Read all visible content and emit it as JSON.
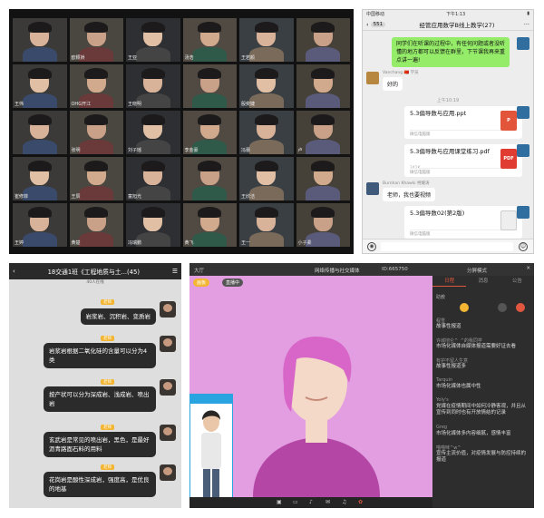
{
  "video_call": {
    "tiles": [
      {
        "name": ""
      },
      {
        "name": "欧颖娇"
      },
      {
        "name": "王亚"
      },
      {
        "name": "汤浩"
      },
      {
        "name": "王若颜"
      },
      {
        "name": ""
      },
      {
        "name": "王伟"
      },
      {
        "name": "OHG开江"
      },
      {
        "name": "王晓明"
      },
      {
        "name": ""
      },
      {
        "name": "殷奕婕"
      },
      {
        "name": ""
      },
      {
        "name": ""
      },
      {
        "name": "张明"
      },
      {
        "name": "刘子瑶"
      },
      {
        "name": "李金豪"
      },
      {
        "name": "冯蕾"
      },
      {
        "name": "卢"
      },
      {
        "name": "崔修菲"
      },
      {
        "name": "王辰"
      },
      {
        "name": "童旭光"
      },
      {
        "name": ""
      },
      {
        "name": "王欣洁"
      },
      {
        "name": ""
      },
      {
        "name": "王婷"
      },
      {
        "name": "黄楚"
      },
      {
        "name": "冯瑞鹏"
      },
      {
        "name": "黄飞"
      },
      {
        "name": "王一"
      },
      {
        "name": "小子柔"
      }
    ]
  },
  "wechat": {
    "status_left": "中国移动",
    "status_time": "下午1:13",
    "back_badge": "551",
    "title": "经管应用数学B线上教学(27)",
    "teacher_msg": "同学们在听课的过程中，有任何问题或者没听懂的地方都可以反馈在群里，下节课我再来重点讲一遍!",
    "student1_name": "Vanchang 🇨🇳 学员",
    "student1_msg": "好的",
    "time_divider": "上午10:19",
    "files": [
      {
        "name": "5.3偏导数与应用.ppt",
        "size": "",
        "type": "P",
        "color": "#e2553a"
      },
      {
        "name": "5.3偏导数与应用课堂练习.pdf",
        "size": "242K",
        "type": "PDF",
        "color": "#e03c31"
      },
      {
        "name": "5.3偏导数02(第2版)",
        "size": "",
        "type": "",
        "color": "#ededed"
      }
    ],
    "file_source": "微信电脑版",
    "student2_name": "Burnhan Khawki 柯耀涛",
    "student2_msg": "老师，我也要视频"
  },
  "qq": {
    "title": "18交通1班《工程地质与土...(45)",
    "subtitle": "40人在线",
    "tag": "老师",
    "messages": [
      "岩浆岩、沉积岩、变质岩",
      "岩浆岩根据二氧化硅的含量可以分为4类",
      "按产状可以分为深成岩、浅成岩、喷出岩",
      "玄武岩是常见的喷出岩，黑色，是最好沥青路面石料的用料",
      "花岗岩是酸性深成岩，强度高，是优良的地基"
    ]
  },
  "live": {
    "header_left": "大厅",
    "title": "网络传播与社交媒体",
    "room_id": "ID:665750",
    "top_right": "分屏模式",
    "tabs": [
      "日程",
      "消息",
      "公告"
    ],
    "stage_btn1": "画板",
    "stage_btn2": "直播中",
    "section": "助教",
    "comments": [
      {
        "name": "程雪",
        "text": "故事性报道"
      },
      {
        "name": "许城彻仑^_^的我同学",
        "text": "市场化媒体自媒体报道需要好证去看"
      },
      {
        "name": "有护不留人生意",
        "text": "故事性报道多"
      },
      {
        "name": "Tarquin",
        "text": "市场化媒体也属中性"
      },
      {
        "name": "Yoly's",
        "text": "党媒在疫情期间中如何冷静客观，并且从宣传到同时也有开放情结的记录"
      },
      {
        "name": "Greg",
        "text": "市场化媒体多内容细腻，感情丰富"
      },
      {
        "name": "喵喵咪^w^",
        "text": "宣传主流价值，对疫情发展与防控持续的报道"
      }
    ]
  }
}
